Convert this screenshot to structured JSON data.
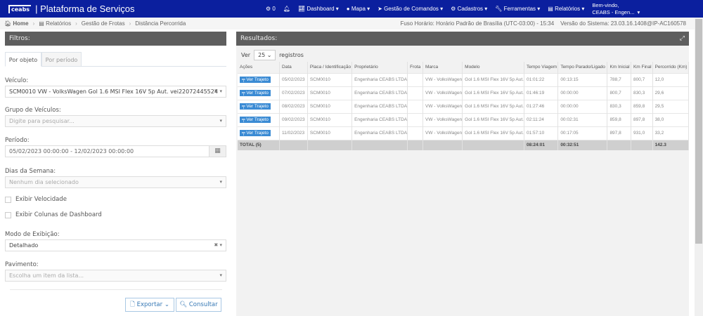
{
  "nav": {
    "logo": "ceabs",
    "title": "Plataforma de Serviços",
    "notif_count": "0",
    "items": [
      "Dashboard",
      "Mapa",
      "Gestão de Comandos",
      "Cadastros",
      "Ferramentas",
      "Relatórios"
    ],
    "welcome": "Bem-vindo,",
    "user": "CEABS - Engen..."
  },
  "breadcrumb": {
    "items": [
      "Home",
      "Relatórios",
      "Gestão de Frotas",
      "Distância Percorrida"
    ],
    "timezone": "Fuso Horário: Horário Padrão de Brasília (UTC-03:00) - 15:34",
    "version": "Versão do Sistema: 23.03.16.1408@IP-AC160578"
  },
  "filters": {
    "title": "Filtros:",
    "tabs": [
      "Por objeto",
      "Por período"
    ],
    "veiculo_label": "Veículo:",
    "veiculo_value": "SCM0010 VW - VolksWagen Gol 1.6 MSI Flex 16V 5p Aut. vei22072445524",
    "grupo_label": "Grupo de Veículos:",
    "grupo_placeholder": "Digite para pesquisar...",
    "periodo_label": "Período:",
    "periodo_value": "05/02/2023 00:00:00 - 12/02/2023 00:00:00",
    "dias_label": "Dias da Semana:",
    "dias_placeholder": "Nenhum dia selecionado",
    "velocidade_label": "Exibir Velocidade",
    "dashboard_label": "Exibir Colunas de Dashboard",
    "modo_label": "Modo de Exibição:",
    "modo_value": "Detalhado",
    "pavimento_label": "Pavimento:",
    "pavimento_placeholder": "Escolha um item da lista...",
    "exportar": "Exportar",
    "consultar": "Consultar"
  },
  "results": {
    "title": "Resultados:",
    "ver": "Ver",
    "page_size": "25",
    "registros": "registros",
    "columns": [
      "Ações",
      "Data",
      "Placa / Identificação",
      "Proprietário",
      "Frota",
      "Marca",
      "Modelo",
      "Tempo Viagem",
      "Tempo Parado/Ligado",
      "Km Inicial",
      "Km Final",
      "Percorrido (Km)"
    ],
    "action_label": "Ver Trajeto",
    "rows": [
      [
        "05/02/2023",
        "SCM0010",
        "Engenharia CEABS LTDA",
        "",
        "VW - VolksWagen",
        "Gol 1.6 MSI Flex 16V 5p Aut.",
        "01:01:22",
        "00:13:15",
        "788,7",
        "800,7",
        "12,0"
      ],
      [
        "07/02/2023",
        "SCM0010",
        "Engenharia CEABS LTDA",
        "",
        "VW - VolksWagen",
        "Gol 1.6 MSI Flex 16V 5p Aut.",
        "01:46:19",
        "00:00:00",
        "800,7",
        "830,3",
        "29,6"
      ],
      [
        "08/02/2023",
        "SCM0010",
        "Engenharia CEABS LTDA",
        "",
        "VW - VolksWagen",
        "Gol 1.6 MSI Flex 16V 5p Aut.",
        "01:27:46",
        "00:00:00",
        "830,3",
        "859,8",
        "29,5"
      ],
      [
        "09/02/2023",
        "SCM0010",
        "Engenharia CEABS LTDA",
        "",
        "VW - VolksWagen",
        "Gol 1.6 MSI Flex 16V 5p Aut.",
        "02:11:24",
        "00:02:31",
        "859,8",
        "897,8",
        "38,0"
      ],
      [
        "11/02/2023",
        "SCM0010",
        "Engenharia CEABS LTDA",
        "",
        "VW - VolksWagen",
        "Gol 1.6 MSI Flex 16V 5p Aut.",
        "01:57:10",
        "00:17:05",
        "897,8",
        "931,0",
        "33,2"
      ]
    ],
    "total": [
      "TOTAL (5)",
      "",
      "",
      "",
      "",
      "",
      "",
      "08:24:01",
      "00:32:51",
      "",
      "",
      "142.3"
    ]
  }
}
